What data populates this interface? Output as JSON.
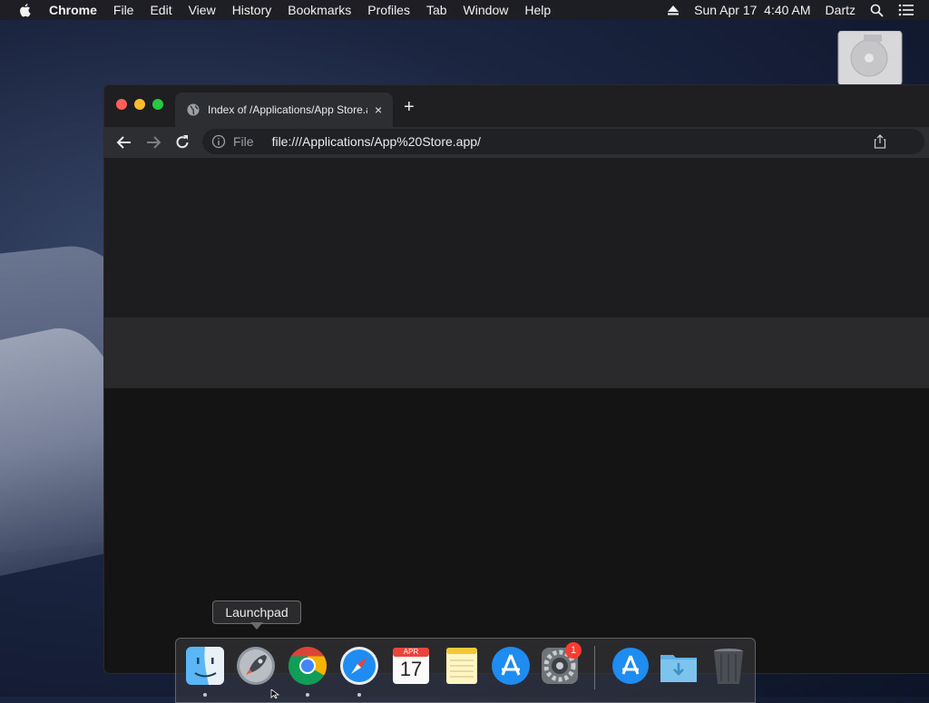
{
  "menubar": {
    "app_name": "Chrome",
    "items": [
      "File",
      "Edit",
      "View",
      "History",
      "Bookmarks",
      "Profiles",
      "Tab",
      "Window",
      "Help"
    ],
    "clock": "Sun Apr 17  4:40 AM",
    "user": "Dartz"
  },
  "browser": {
    "tab_title": "Index of /Applications/App Store.app/",
    "new_tab": "+",
    "close_tab": "×",
    "omnibox": {
      "scheme_label": "File",
      "url": "file:///Applications/App%20Store.app/"
    }
  },
  "dock": {
    "tooltip": "Launchpad",
    "items": [
      {
        "name": "Finder",
        "running": true
      },
      {
        "name": "Launchpad",
        "running": false
      },
      {
        "name": "Google Chrome",
        "running": true
      },
      {
        "name": "Safari",
        "running": true
      },
      {
        "name": "Calendar",
        "month": "APR",
        "day": "17",
        "running": false
      },
      {
        "name": "Notes",
        "running": false
      },
      {
        "name": "App Store",
        "running": false
      },
      {
        "name": "System Preferences",
        "badge": "1",
        "running": false
      },
      {
        "name": "Applications stack",
        "running": false
      },
      {
        "name": "Downloads",
        "running": false
      },
      {
        "name": "Trash",
        "running": false
      }
    ]
  },
  "colors": {
    "close": "#fe5f57",
    "minimize": "#febc2e",
    "zoom": "#28c840",
    "badge": "#ff3b30"
  }
}
